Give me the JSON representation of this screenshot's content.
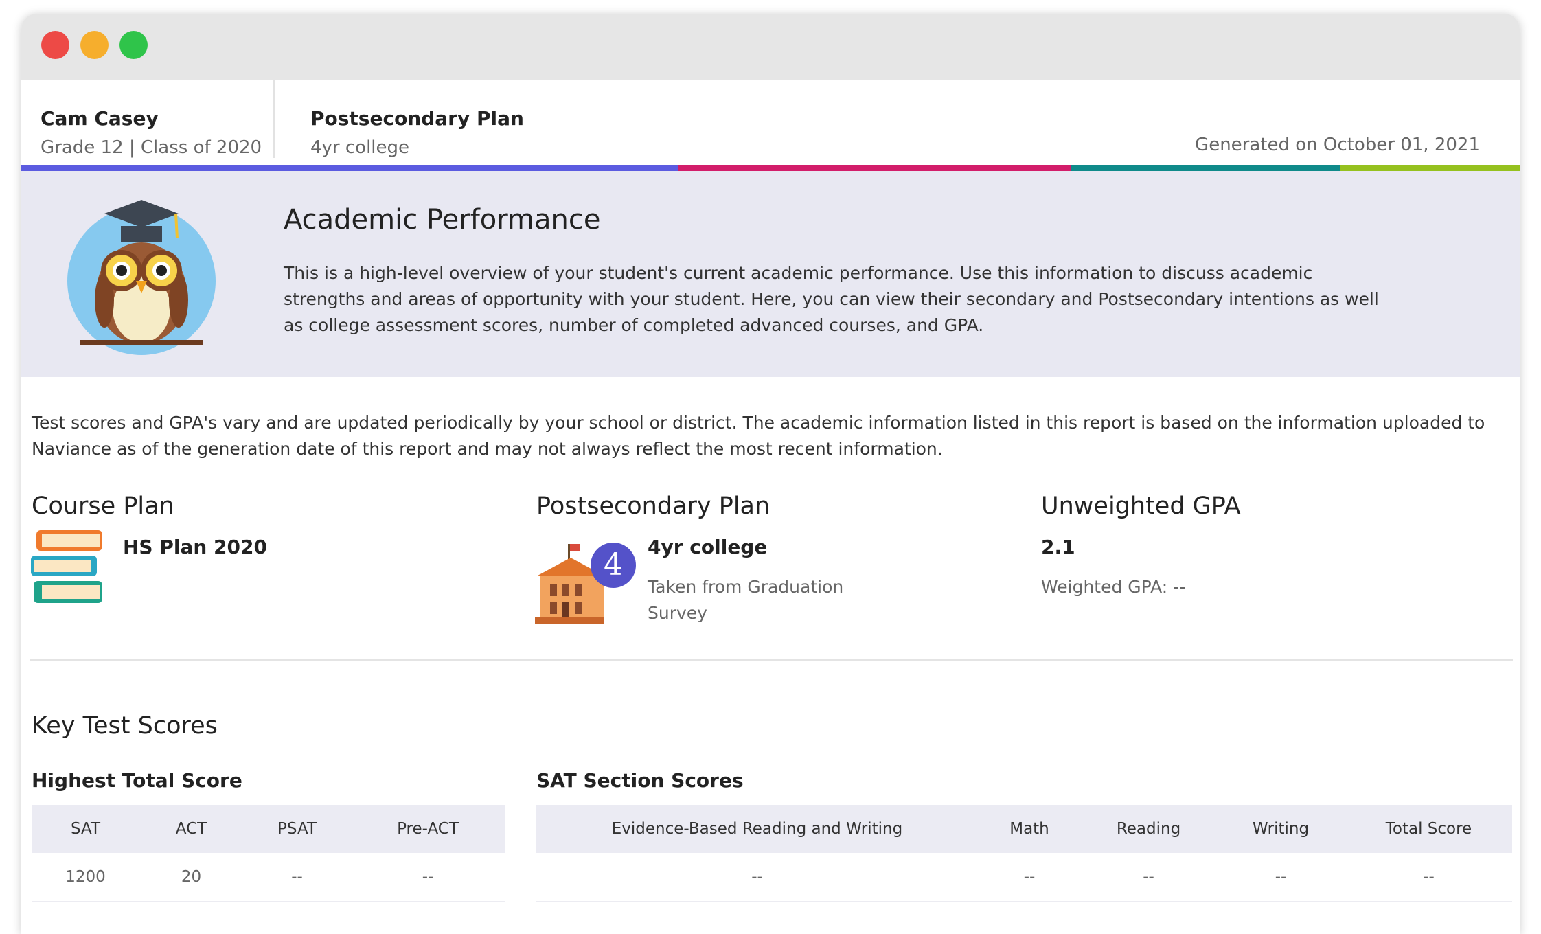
{
  "header": {
    "student_name": "Cam Casey",
    "grade_line": "Grade 12 | Class of 2020",
    "plan_title": "Postsecondary Plan",
    "plan_value": "4yr college",
    "generated": "Generated on October 01, 2021"
  },
  "colors": {
    "accent_bar": [
      "#5b5be0",
      "#d21d6a",
      "#0f8a8a",
      "#95c11f"
    ],
    "banner_bg": "#e8e8f2"
  },
  "banner": {
    "title": "Academic Performance",
    "text": "This is a high-level overview of your student's current academic performance. Use this information to discuss academic strengths and areas of opportunity with your student. Here, you can view their secondary and Postsecondary intentions as well as college assessment scores, number of completed advanced courses, and GPA."
  },
  "notice": "Test scores and GPA's vary and are updated periodically by your school or district. The academic information listed in this report is based on the information uploaded to Naviance as of the generation date of this report and may not always reflect the most recent information.",
  "course_plan": {
    "title": "Course Plan",
    "value": "HS Plan 2020"
  },
  "postsecondary": {
    "title": "Postsecondary Plan",
    "value": "4yr college",
    "badge": "4",
    "source": "Taken from Graduation Survey"
  },
  "gpa": {
    "title": "Unweighted GPA",
    "value": "2.1",
    "weighted": "Weighted GPA: --"
  },
  "key_test_scores": {
    "title": "Key Test Scores",
    "highest": {
      "title": "Highest Total Score",
      "headers": [
        "SAT",
        "ACT",
        "PSAT",
        "Pre-ACT"
      ],
      "row": [
        "1200",
        "20",
        "--",
        "--"
      ]
    },
    "sat_sections": {
      "title": "SAT Section Scores",
      "headers": [
        "Evidence-Based Reading and Writing",
        "Math",
        "Reading",
        "Writing",
        "Total Score"
      ],
      "row": [
        "--",
        "--",
        "--",
        "--",
        "--"
      ]
    }
  }
}
